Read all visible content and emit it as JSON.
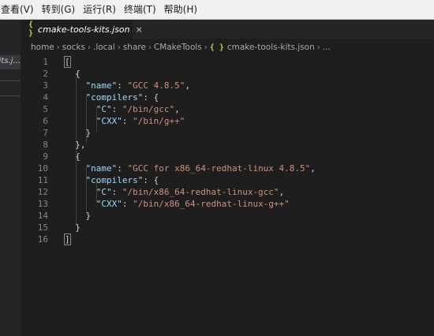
{
  "menubar": [
    "查看(V)",
    "转到(G)",
    "运行(R)",
    "终端(T)",
    "帮助(H)"
  ],
  "sidebar": {
    "file_label": "its.j..."
  },
  "tab": {
    "icon": "{ }",
    "label": "cmake-tools-kits.json",
    "close": "×"
  },
  "breadcrumbs": {
    "items": [
      "home",
      "socks",
      ".local",
      "share",
      "CMakeTools",
      "cmake-tools-kits.json",
      "..."
    ],
    "file_icon": "{ }",
    "separator": "›"
  },
  "editor": {
    "lines": [
      [
        {
          "t": "[",
          "c": "p bm"
        }
      ],
      [
        {
          "t": "  {",
          "c": "p"
        }
      ],
      [
        {
          "t": "    ",
          "c": "p"
        },
        {
          "t": "\"name\"",
          "c": "k"
        },
        {
          "t": ": ",
          "c": "p"
        },
        {
          "t": "\"GCC 4.8.5\"",
          "c": "s"
        },
        {
          "t": ",",
          "c": "p"
        }
      ],
      [
        {
          "t": "    ",
          "c": "p"
        },
        {
          "t": "\"compilers\"",
          "c": "k"
        },
        {
          "t": ": {",
          "c": "p"
        }
      ],
      [
        {
          "t": "      ",
          "c": "p"
        },
        {
          "t": "\"C\"",
          "c": "k"
        },
        {
          "t": ": ",
          "c": "p"
        },
        {
          "t": "\"/bin/gcc\"",
          "c": "s"
        },
        {
          "t": ",",
          "c": "p"
        }
      ],
      [
        {
          "t": "      ",
          "c": "p"
        },
        {
          "t": "\"CXX\"",
          "c": "k"
        },
        {
          "t": ": ",
          "c": "p"
        },
        {
          "t": "\"/bin/g++\"",
          "c": "s"
        }
      ],
      [
        {
          "t": "    }",
          "c": "p"
        }
      ],
      [
        {
          "t": "  },",
          "c": "p"
        }
      ],
      [
        {
          "t": "  {",
          "c": "p"
        }
      ],
      [
        {
          "t": "    ",
          "c": "p"
        },
        {
          "t": "\"name\"",
          "c": "k"
        },
        {
          "t": ": ",
          "c": "p"
        },
        {
          "t": "\"GCC for x86_64-redhat-linux 4.8.5\"",
          "c": "s"
        },
        {
          "t": ",",
          "c": "p"
        }
      ],
      [
        {
          "t": "    ",
          "c": "p"
        },
        {
          "t": "\"compilers\"",
          "c": "k"
        },
        {
          "t": ": {",
          "c": "p"
        }
      ],
      [
        {
          "t": "      ",
          "c": "p"
        },
        {
          "t": "\"C\"",
          "c": "k"
        },
        {
          "t": ": ",
          "c": "p"
        },
        {
          "t": "\"/bin/x86_64-redhat-linux-gcc\"",
          "c": "s"
        },
        {
          "t": ",",
          "c": "p"
        }
      ],
      [
        {
          "t": "      ",
          "c": "p"
        },
        {
          "t": "\"CXX\"",
          "c": "k"
        },
        {
          "t": ": ",
          "c": "p"
        },
        {
          "t": "\"/bin/x86_64-redhat-linux-g++\"",
          "c": "s"
        }
      ],
      [
        {
          "t": "    }",
          "c": "p"
        }
      ],
      [
        {
          "t": "  }",
          "c": "p"
        }
      ],
      [
        {
          "t": "]",
          "c": "p bm"
        }
      ]
    ]
  },
  "colors": {
    "background": "#1e1e1e",
    "key": "#9cdcfe",
    "string": "#ce9178",
    "punct": "#d4d4d4",
    "line_number": "#858585",
    "json_icon": "#cbcb41"
  }
}
